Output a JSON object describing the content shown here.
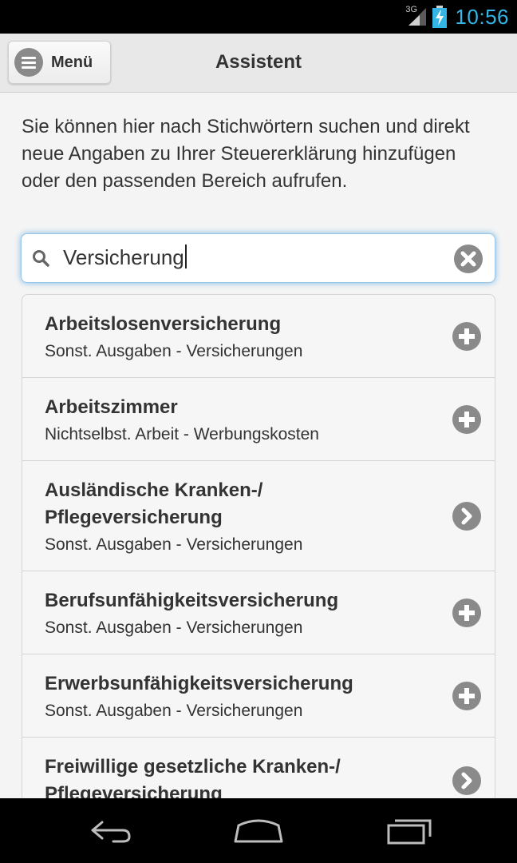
{
  "status_bar": {
    "network": "3G",
    "time": "10:56",
    "icons": [
      "signal-icon",
      "battery-charging-icon"
    ]
  },
  "header": {
    "menu_label": "Menü",
    "title": "Assistent"
  },
  "intro_text": "Sie können hier nach Stichwörtern suchen und direkt neue Angaben zu Ihrer Steuererklärung hinzufügen oder den passenden Bereich aufrufen.",
  "search": {
    "value": "Versicherung"
  },
  "results": [
    {
      "title": "Arbeitslosenversicherung",
      "subtitle": "Sonst. Ausgaben - Versicherungen",
      "action": "add"
    },
    {
      "title": "Arbeitszimmer",
      "subtitle": "Nichtselbst. Arbeit - Werbungskosten",
      "action": "add"
    },
    {
      "title": "Ausländische Kranken-/ Pflegeversicherung",
      "subtitle": "Sonst. Ausgaben - Versicherungen",
      "action": "navigate"
    },
    {
      "title": "Berufsunfähigkeitsversicherung",
      "subtitle": "Sonst. Ausgaben - Versicherungen",
      "action": "add"
    },
    {
      "title": "Erwerbsunfähigkeitsversicherung",
      "subtitle": "Sonst. Ausgaben - Versicherungen",
      "action": "add"
    },
    {
      "title": "Freiwillige gesetzliche Kranken-/ Pflegeversicherung",
      "subtitle": "",
      "action": "navigate"
    }
  ],
  "colors": {
    "clock": "#33b5e5",
    "search_focus": "#79b8e6",
    "icon_gray": "#8a8a8a"
  },
  "nav_bar": {
    "icons": [
      "back-icon",
      "home-icon",
      "recent-apps-icon"
    ]
  }
}
